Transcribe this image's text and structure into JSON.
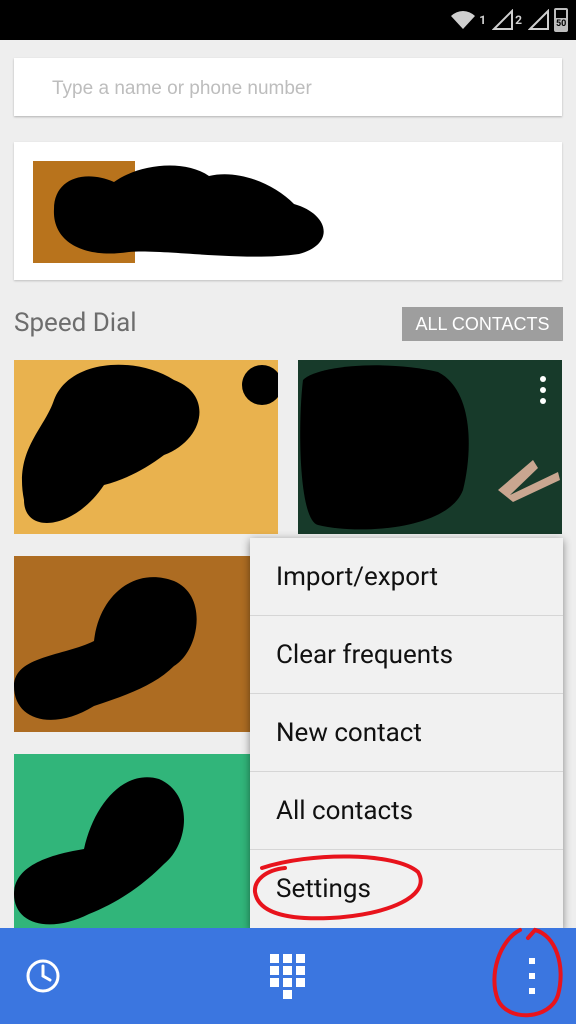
{
  "status_bar": {
    "sim1": "1",
    "sim2": "2",
    "battery": "50"
  },
  "search": {
    "placeholder": "Type a name or phone number",
    "value": ""
  },
  "speed_dial": {
    "title": "Speed Dial",
    "all_contacts_label": "ALL CONTACTS"
  },
  "menu": {
    "items": [
      {
        "label": "Import/export"
      },
      {
        "label": "Clear frequents"
      },
      {
        "label": "New contact"
      },
      {
        "label": "All contacts"
      },
      {
        "label": "Settings"
      }
    ]
  },
  "bottom_bar": {
    "icons": [
      "history-icon",
      "dialpad-icon",
      "overflow-menu-icon"
    ]
  },
  "colors": {
    "accent": "#3b76e0",
    "annotation": "#e8131c",
    "tile_1": "#e9b24e",
    "tile_2": "#173a2a",
    "tile_3": "#ad6c22",
    "tile_4": "#31b57a"
  }
}
